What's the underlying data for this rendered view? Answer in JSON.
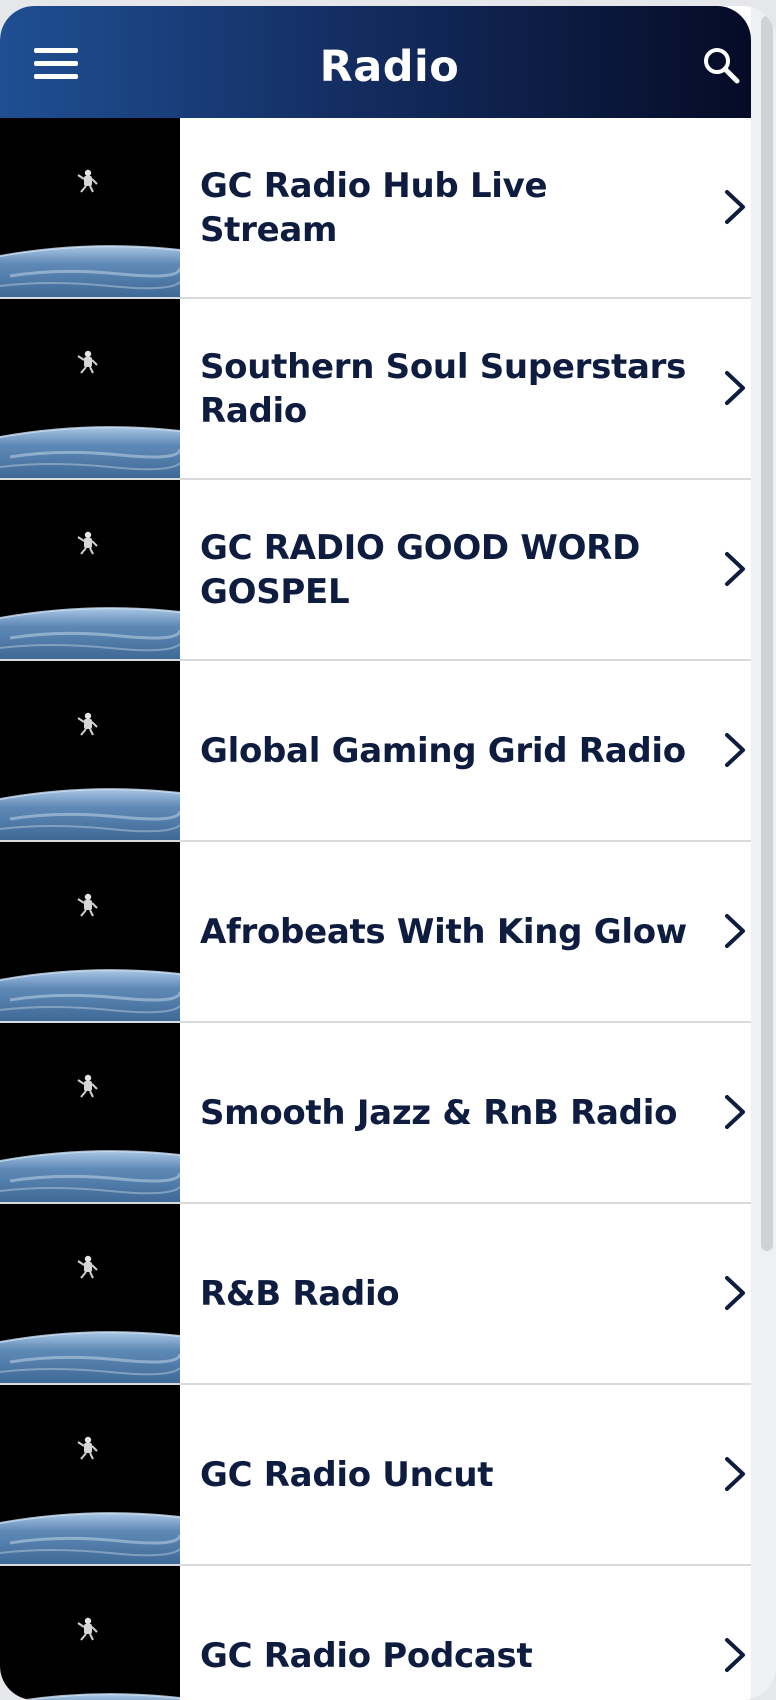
{
  "header": {
    "title": "Radio",
    "menu_icon": "hamburger-menu-icon",
    "search_icon": "search-icon",
    "gradient": [
      "#1f4f93",
      "#050b26"
    ]
  },
  "stations": [
    {
      "name": "GC Radio Hub Live Stream"
    },
    {
      "name": "Southern Soul Superstars Radio"
    },
    {
      "name": "GC RADIO GOOD WORD GOSPEL"
    },
    {
      "name": "Global Gaming Grid Radio"
    },
    {
      "name": "Afrobeats With King Glow"
    },
    {
      "name": "Smooth Jazz & RnB Radio"
    },
    {
      "name": "R&B Radio"
    },
    {
      "name": "GC Radio Uncut"
    },
    {
      "name": "GC Radio Podcast"
    }
  ],
  "row_icon": "chevron-right-icon",
  "colors": {
    "text": "#0e1c3f",
    "divider": "#d9dadd"
  }
}
